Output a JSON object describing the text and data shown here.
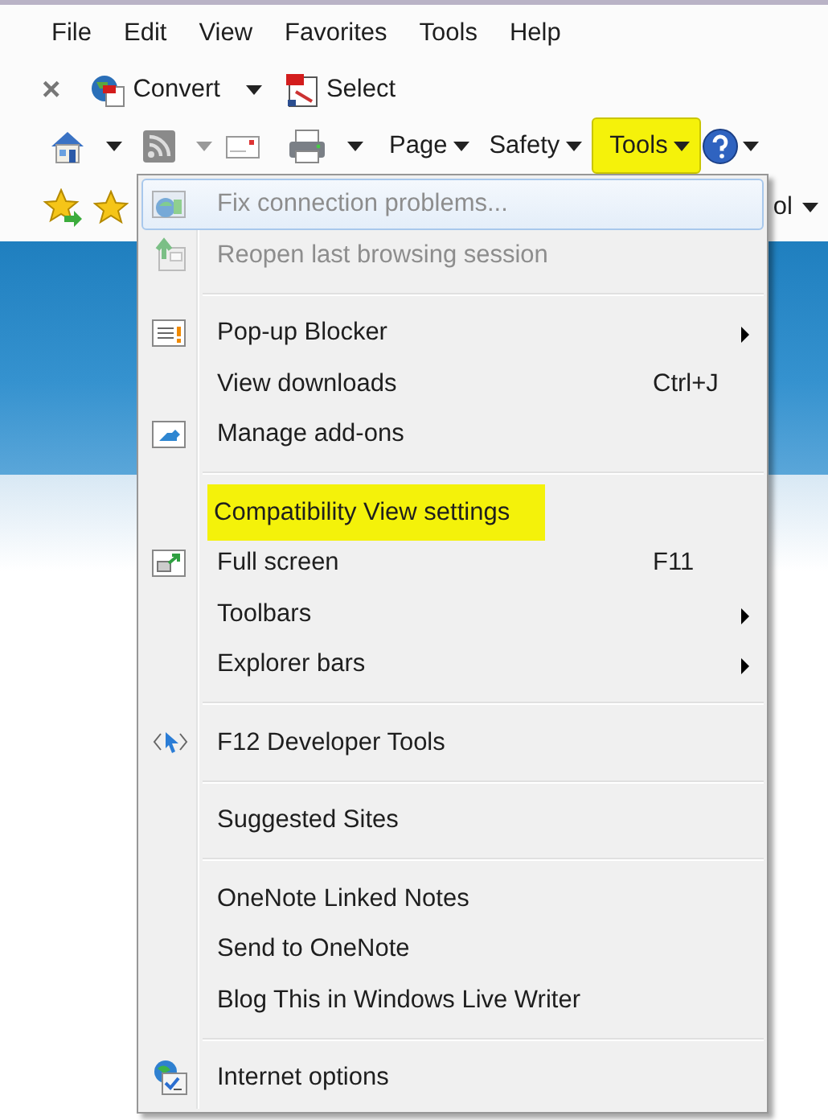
{
  "menu_bar": {
    "items": [
      "File",
      "Edit",
      "View",
      "Favorites",
      "Tools",
      "Help"
    ]
  },
  "pdf_toolbar": {
    "close": "×",
    "buttons": [
      {
        "label": "Convert",
        "dropdown": true
      },
      {
        "label": "Select",
        "dropdown": false
      }
    ]
  },
  "command_bar": {
    "buttons": [
      {
        "label": "Page",
        "highlighted": false
      },
      {
        "label": "Safety",
        "highlighted": false
      },
      {
        "label": "Tools",
        "highlighted": true
      }
    ]
  },
  "favorites_bar": {
    "cut_label": "ol"
  },
  "tools_menu": {
    "groups": [
      [
        {
          "label": "Fix connection problems...",
          "disabled": true,
          "hovered": true,
          "highlighted": false,
          "submenu": false
        },
        {
          "label": "Reopen last browsing session",
          "disabled": true,
          "hovered": false,
          "highlighted": false,
          "submenu": false
        }
      ],
      [
        {
          "label": "Pop-up Blocker",
          "disabled": false,
          "hovered": false,
          "highlighted": false,
          "submenu": true
        },
        {
          "label": "View downloads",
          "shortcut": "Ctrl+J",
          "disabled": false,
          "hovered": false,
          "highlighted": false,
          "submenu": false
        },
        {
          "label": "Manage add-ons",
          "disabled": false,
          "hovered": false,
          "highlighted": false,
          "submenu": false
        }
      ],
      [
        {
          "label": "Compatibility View settings",
          "disabled": false,
          "hovered": false,
          "highlighted": true,
          "submenu": false
        },
        {
          "label": "Full screen",
          "shortcut": "F11",
          "disabled": false,
          "hovered": false,
          "highlighted": false,
          "submenu": false
        },
        {
          "label": "Toolbars",
          "disabled": false,
          "hovered": false,
          "highlighted": false,
          "submenu": true
        },
        {
          "label": "Explorer bars",
          "disabled": false,
          "hovered": false,
          "highlighted": false,
          "submenu": true
        }
      ],
      [
        {
          "label": "F12 Developer Tools",
          "disabled": false,
          "hovered": false,
          "highlighted": false,
          "submenu": false
        }
      ],
      [
        {
          "label": "Suggested Sites",
          "disabled": false,
          "hovered": false,
          "highlighted": false,
          "submenu": false
        }
      ],
      [
        {
          "label": "OneNote Linked Notes",
          "disabled": false,
          "hovered": false,
          "highlighted": false,
          "submenu": false
        },
        {
          "label": "Send to OneNote",
          "disabled": false,
          "hovered": false,
          "highlighted": false,
          "submenu": false
        },
        {
          "label": "Blog This in Windows Live Writer",
          "disabled": false,
          "hovered": false,
          "highlighted": false,
          "submenu": false
        }
      ],
      [
        {
          "label": "Internet options",
          "disabled": false,
          "hovered": false,
          "highlighted": false,
          "submenu": false
        }
      ]
    ]
  }
}
